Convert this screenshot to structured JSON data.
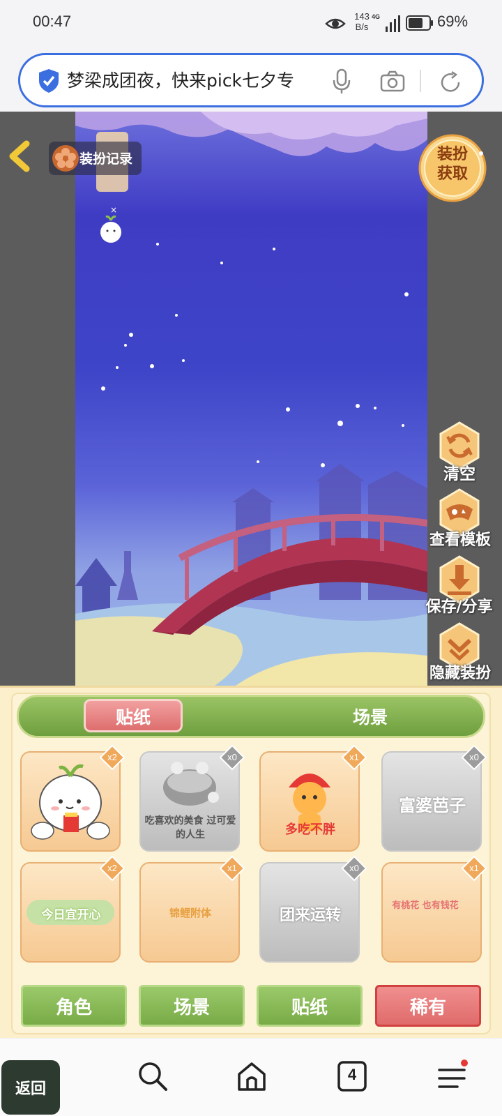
{
  "status_bar": {
    "time": "00:47",
    "net_speed_value": "143",
    "net_speed_unit": "B/s",
    "network_type": "4G",
    "battery": "69%",
    "icons": [
      "eye-icon",
      "signal-icon",
      "battery-icon"
    ]
  },
  "address_bar": {
    "text": "梦梁成团夜，快来pick七夕专",
    "icons": [
      "shield-icon",
      "mic-icon",
      "camera-icon",
      "reload-icon"
    ]
  },
  "game": {
    "dress_record_label": "装扮记录",
    "acquire_line1": "装扮",
    "acquire_line2": "获取",
    "side_actions": [
      {
        "label": "清空",
        "icon": "refresh-icon"
      },
      {
        "label": "查看模板",
        "icon": "template-icon"
      },
      {
        "label": "保存/分享",
        "icon": "download-icon"
      },
      {
        "label": "隐藏装扮",
        "icon": "hide-icon"
      }
    ]
  },
  "panel": {
    "tabs": [
      {
        "label": "贴纸",
        "active": true
      },
      {
        "label": "场景",
        "active": false
      }
    ],
    "items": [
      {
        "count": "x2",
        "owned": true,
        "caption": ""
      },
      {
        "count": "x0",
        "owned": false,
        "caption": "吃喜欢的美食 过可爱的人生"
      },
      {
        "count": "x1",
        "owned": true,
        "caption": "多吃不胖"
      },
      {
        "count": "x0",
        "owned": false,
        "caption": "富婆芭子"
      },
      {
        "count": "x2",
        "owned": true,
        "caption": "今日宜开心"
      },
      {
        "count": "x1",
        "owned": true,
        "caption": "锦鲤附体"
      },
      {
        "count": "x0",
        "owned": false,
        "caption": "团来运转"
      },
      {
        "count": "x1",
        "owned": true,
        "caption": "有桃花 也有钱花"
      }
    ],
    "categories": [
      {
        "label": "角色",
        "style": "green"
      },
      {
        "label": "场景",
        "style": "green"
      },
      {
        "label": "贴纸",
        "style": "green"
      },
      {
        "label": "稀有",
        "style": "red"
      }
    ]
  },
  "bottom_nav": {
    "back_label": "返回",
    "tab_count": "4",
    "icons": [
      "search-icon",
      "home-icon",
      "tabs-icon",
      "menu-icon"
    ]
  },
  "colors": {
    "accent_blue": "#3b6fe0",
    "sky_purple": "#3f3cc4",
    "tab_green": "#78ab46",
    "rare_red": "#e06b6b"
  }
}
